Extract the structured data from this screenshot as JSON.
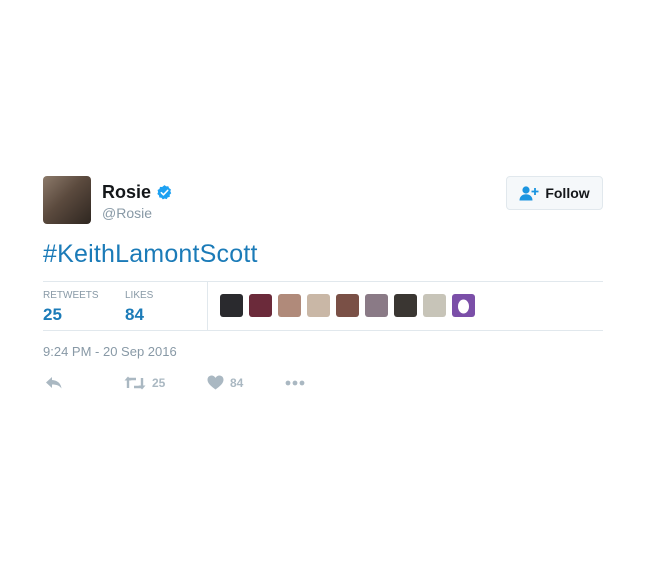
{
  "tweet": {
    "author": {
      "name": "Rosie",
      "handle": "@Rosie",
      "verified_icon": "verified-badge-icon",
      "avatar_colors": [
        "#8c7a6a",
        "#5b4a3e",
        "#2e2620"
      ]
    },
    "follow_button": {
      "label": "Follow",
      "icon": "add-user-icon"
    },
    "text": "#KeithLamontScott",
    "stats": {
      "retweets_label": "RETWEETS",
      "retweets_value": "25",
      "likes_label": "LIKES",
      "likes_value": "84"
    },
    "liker_avatars": [
      {
        "color": "#2a2a2e"
      },
      {
        "color": "#6b2a3a"
      },
      {
        "color": "#b08a7a"
      },
      {
        "color": "#c9b7a6"
      },
      {
        "color": "#7a5046"
      },
      {
        "color": "#8a7a86"
      },
      {
        "color": "#3a3632"
      },
      {
        "color": "#c7c4b8"
      },
      {
        "color": "#7b4fa8"
      }
    ],
    "timestamp": "9:24 PM - 20 Sep 2016",
    "actions": {
      "reply_icon": "reply-icon",
      "retweet_icon": "retweet-icon",
      "retweet_count": "25",
      "like_icon": "heart-icon",
      "like_count": "84",
      "more_icon": "more-dots-icon"
    },
    "colors": {
      "link": "#1b7bb8",
      "verified": "#1da1f2",
      "muted": "#8899a6",
      "action": "#aab8c2"
    }
  }
}
